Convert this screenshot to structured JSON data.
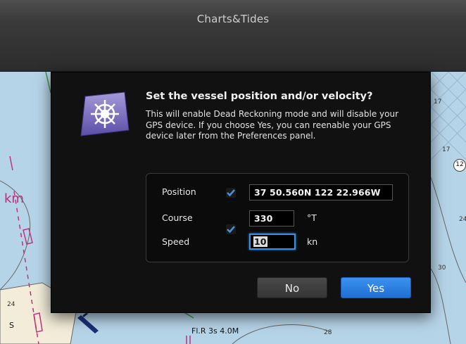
{
  "window": {
    "title": "Charts&Tides"
  },
  "map": {
    "scale_label": "km",
    "depth_labels": [
      "17",
      "17",
      "24",
      "30",
      "28",
      "24"
    ],
    "badge": "12",
    "buoy_label": "Fl.R 3s 4.0M",
    "letter_label": "S"
  },
  "dialog": {
    "heading": "Set the vessel position and/or velocity?",
    "message": "This will enable Dead Reckoning mode and will disable your GPS device. If you choose Yes, you can reenable your GPS device later from the Preferences panel.",
    "fields": {
      "position_label": "Position",
      "position_value": "37 50.560N 122 22.966W",
      "position_checked": true,
      "course_label": "Course",
      "course_value": "330",
      "course_unit": "°T",
      "speed_label": "Speed",
      "speed_value": "10",
      "speed_unit": "kn",
      "velocity_checked": true
    },
    "buttons": {
      "no": "No",
      "yes": "Yes"
    },
    "colors": {
      "accent": "#2a7fe0",
      "checkmark": "#4a90d9"
    }
  }
}
